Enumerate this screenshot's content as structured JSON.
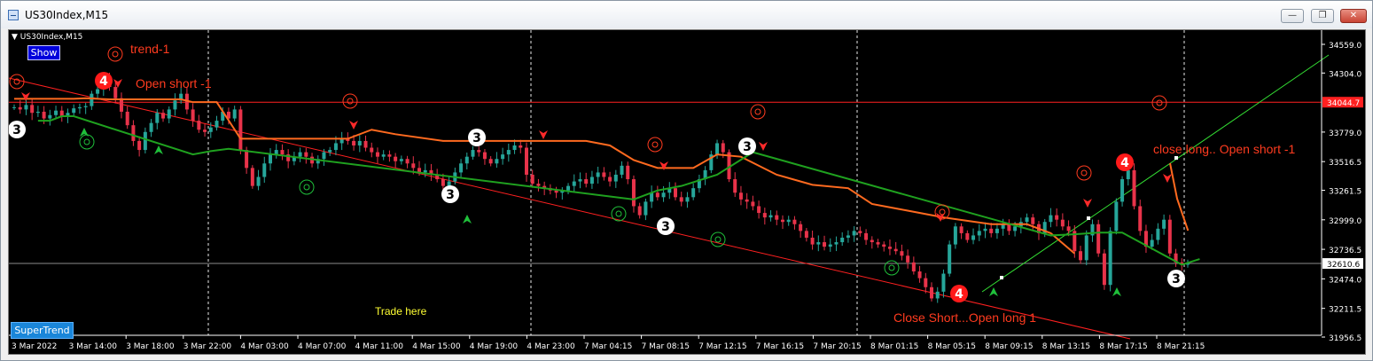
{
  "window": {
    "title": "US30Index,M15",
    "buttons": [
      "minimize",
      "restore",
      "close"
    ],
    "icons": {
      "minimize": "minimize-icon",
      "restore": "restore-icon",
      "close": "close-icon"
    }
  },
  "chart_label": "US30Index,M15",
  "buttons": {
    "show": "Show",
    "supertrend": "SuperTrend"
  },
  "colors": {
    "background": "#000000",
    "bull_candle": "#26a69a",
    "bear_candle": "#e8334a",
    "supertrend_down": "#ff6a1f",
    "supertrend_up": "#1fa11f",
    "trendline": "#ff2020",
    "resistance_line": "#ff2020",
    "price_line": "#8d8d8d",
    "uptrend_line": "#33dd33",
    "annotation_text": "#ff3b1f",
    "trade_here_text": "#ffff33"
  },
  "chart_data": {
    "type": "candlestick",
    "symbol": "US30Index",
    "timeframe": "M15",
    "ylim": [
      31956.5,
      34559.0
    ],
    "y_ticks": [
      34559.0,
      34304.0,
      34044.7,
      33779.0,
      33516.5,
      33261.5,
      32999.0,
      32736.5,
      32610.6,
      32474.0,
      32211.5,
      31956.5
    ],
    "y_tick_labels": [
      "34559.0",
      "34304.0",
      "34044.7",
      "33779.0",
      "33516.5",
      "33261.5",
      "32999.0",
      "32736.5",
      "32610.6",
      "32474.0",
      "32211.5",
      "31956.5"
    ],
    "x_tick_labels": [
      "3 Mar 2022",
      "3 Mar 14:00",
      "3 Mar 18:00",
      "3 Mar 22:00",
      "4 Mar 03:00",
      "4 Mar 07:00",
      "4 Mar 11:00",
      "4 Mar 15:00",
      "4 Mar 19:00",
      "4 Mar 23:00",
      "7 Mar 04:15",
      "7 Mar 08:15",
      "7 Mar 12:15",
      "7 Mar 16:15",
      "7 Mar 20:15",
      "8 Mar 01:15",
      "8 Mar 05:15",
      "8 Mar 09:15",
      "8 Mar 13:15",
      "8 Mar 17:15",
      "8 Mar 21:15"
    ],
    "price_lines": [
      {
        "name": "resistance",
        "value": 34044.7,
        "label": "34044.7"
      },
      {
        "name": "current-price",
        "value": 32610.6,
        "label": "32610.6"
      }
    ],
    "closes": [
      34000,
      33980,
      34020,
      33950,
      33960,
      33900,
      33930,
      33970,
      33920,
      33950,
      33990,
      34000,
      34010,
      34120,
      34160,
      34250,
      34180,
      34080,
      33960,
      33840,
      33700,
      33620,
      33780,
      33860,
      33950,
      33900,
      33980,
      34060,
      34120,
      33980,
      33880,
      33800,
      33780,
      33820,
      33880,
      33960,
      33900,
      33980,
      33620,
      33460,
      33300,
      33380,
      33500,
      33580,
      33620,
      33580,
      33520,
      33560,
      33600,
      33560,
      33500,
      33540,
      33600,
      33620,
      33680,
      33720,
      33700,
      33660,
      33700,
      33640,
      33600,
      33560,
      33580,
      33560,
      33520,
      33540,
      33500,
      33460,
      33420,
      33440,
      33400,
      33360,
      33300,
      33340,
      33420,
      33500,
      33560,
      33620,
      33600,
      33540,
      33500,
      33540,
      33580,
      33620,
      33660,
      33640,
      33400,
      33320,
      33300,
      33280,
      33260,
      33240,
      33260,
      33300,
      33340,
      33360,
      33320,
      33380,
      33420,
      33380,
      33340,
      33400,
      33480,
      33360,
      33120,
      33040,
      33160,
      33240,
      33200,
      33240,
      33280,
      33200,
      33160,
      33200,
      33280,
      33360,
      33440,
      33580,
      33680,
      33600,
      33360,
      33240,
      33180,
      33160,
      33120,
      33060,
      33020,
      33040,
      33000,
      32980,
      33000,
      32960,
      32900,
      32840,
      32780,
      32800,
      32760,
      32780,
      32800,
      32840,
      32860,
      32900,
      32880,
      32820,
      32800,
      32780,
      32760,
      32740,
      32720,
      32680,
      32620,
      32540,
      32480,
      32400,
      32300,
      32360,
      32520,
      32780,
      32940,
      32880,
      32820,
      32860,
      32900,
      32920,
      32880,
      32920,
      32960,
      32900,
      32940,
      32980,
      33020,
      32960,
      32880,
      32980,
      33040,
      33000,
      32940,
      32900,
      32720,
      32640,
      32860,
      32960,
      32700,
      32420,
      32900,
      33160,
      33360,
      33440,
      33120,
      32900,
      32760,
      32820,
      32920,
      33000,
      32700,
      32620,
      32600,
      32610.6
    ],
    "supertrend_down": [
      [
        0,
        34075
      ],
      [
        10,
        34075
      ],
      [
        12,
        34080
      ],
      [
        16,
        34070
      ],
      [
        28,
        34070
      ],
      [
        30,
        34045
      ],
      [
        34,
        34045
      ],
      [
        38,
        33720
      ],
      [
        56,
        33720
      ],
      [
        60,
        33800
      ],
      [
        64,
        33760
      ],
      [
        72,
        33700
      ],
      [
        96,
        33700
      ],
      [
        100,
        33660
      ],
      [
        104,
        33530
      ],
      [
        108,
        33460
      ],
      [
        114,
        33460
      ],
      [
        118,
        33580
      ],
      [
        122,
        33560
      ],
      [
        128,
        33400
      ],
      [
        134,
        33310
      ],
      [
        140,
        33280
      ],
      [
        144,
        33140
      ],
      [
        150,
        33080
      ],
      [
        156,
        33020
      ],
      [
        164,
        32960
      ],
      [
        170,
        32960
      ],
      [
        174,
        32880
      ],
      [
        178,
        32700
      ]
    ],
    "supertrend_up": [
      [
        4,
        33880
      ],
      [
        6,
        33880
      ],
      [
        8,
        33920
      ],
      [
        10,
        33920
      ],
      [
        30,
        33580
      ],
      [
        33,
        33610
      ],
      [
        36,
        33630
      ],
      [
        104,
        33180
      ],
      [
        108,
        33260
      ],
      [
        112,
        33300
      ],
      [
        118,
        33400
      ],
      [
        124,
        33600
      ],
      [
        174,
        32860
      ],
      [
        178,
        32870
      ],
      [
        182,
        32885
      ],
      [
        186,
        32885
      ],
      [
        196,
        32600
      ],
      [
        199,
        32650
      ]
    ],
    "annotations": [
      "trend-1",
      "Open short -1",
      "close long.. Open short -1",
      "Close Short...Open long 1",
      "Trade here"
    ],
    "markers": [
      {
        "label": "3",
        "style": "white-circle"
      },
      {
        "label": "4",
        "style": "red-circle"
      },
      {
        "label": "3",
        "style": "white-circle"
      },
      {
        "label": "3",
        "style": "white-circle"
      },
      {
        "label": "3",
        "style": "white-circle"
      },
      {
        "label": "3",
        "style": "white-circle"
      },
      {
        "label": "4",
        "style": "red-circle"
      },
      {
        "label": "4",
        "style": "red-circle"
      },
      {
        "label": "3",
        "style": "white-circle"
      }
    ],
    "grid": false,
    "legend": "none"
  }
}
